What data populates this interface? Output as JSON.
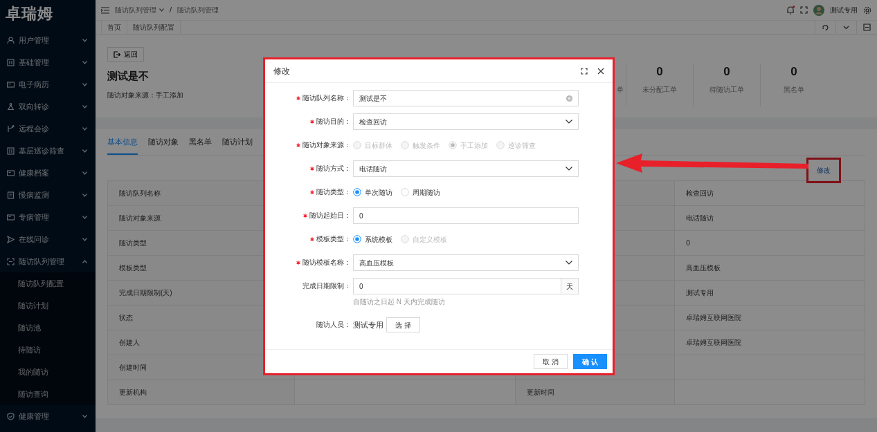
{
  "logo": "卓瑞姆",
  "sidebar": {
    "items": [
      {
        "label": "用户管理",
        "expanded": false
      },
      {
        "label": "基础管理",
        "expanded": false
      },
      {
        "label": "电子病历",
        "expanded": false
      },
      {
        "label": "双向转诊",
        "expanded": false
      },
      {
        "label": "远程会诊",
        "expanded": false
      },
      {
        "label": "基层巡诊筛查",
        "expanded": false
      },
      {
        "label": "健康档案",
        "expanded": false
      },
      {
        "label": "慢病监测",
        "expanded": false
      },
      {
        "label": "专病管理",
        "expanded": false
      },
      {
        "label": "在线问诊",
        "expanded": false
      },
      {
        "label": "随访队列管理",
        "expanded": true,
        "children": [
          {
            "label": "随访队列配置"
          },
          {
            "label": "随访计划"
          },
          {
            "label": "随访池"
          },
          {
            "label": "待随访"
          },
          {
            "label": "我的随访"
          },
          {
            "label": "随访查询"
          }
        ]
      },
      {
        "label": "健康管理",
        "expanded": false
      }
    ]
  },
  "header": {
    "breadcrumb": [
      {
        "label": "随访队列管理",
        "dropdown": true
      },
      {
        "label": "随访队列管理",
        "dropdown": false
      }
    ],
    "separator": "/",
    "has_unread": true,
    "user": "测试专用"
  },
  "page_tabs": [
    {
      "label": "首页"
    },
    {
      "label": "随访队列配置"
    }
  ],
  "summary": {
    "back_button": "返回",
    "title": "测试是不",
    "source": "随访对象来源：手工添加",
    "stats": [
      {
        "label": "单"
      },
      {
        "value": "0",
        "label": "未分配工单"
      },
      {
        "value": "0",
        "label": "待随访工单"
      },
      {
        "value": "0",
        "label": "黑名单"
      }
    ]
  },
  "tabs": [
    {
      "label": "基本信息",
      "selected": true
    },
    {
      "label": "随访对象",
      "selected": false
    },
    {
      "label": "黑名单",
      "selected": false
    },
    {
      "label": "随访计划",
      "selected": false
    }
  ],
  "edit_link": "修改",
  "table": {
    "rows": [
      {
        "label": "随访队列名称",
        "value_2": "检查回访"
      },
      {
        "label": "随访对象来源",
        "value_2": "电话随访"
      },
      {
        "label": "随访类型",
        "value_2": "0"
      },
      {
        "label": "模板类型",
        "value_2": "高血压模板"
      },
      {
        "label": "完成日期限制(天)",
        "value_2": "测试专用"
      },
      {
        "label": "状态",
        "value_2": "卓瑞姆互联网医院"
      },
      {
        "label": "创建人",
        "value_2": "卓瑞姆互联网医院"
      },
      {
        "label": "创建时间"
      },
      {
        "label": "更新机构",
        "label_2": "更新时间"
      }
    ]
  },
  "modal": {
    "title": "修改",
    "fields": [
      {
        "kind": "input",
        "label": "随访队列名称：",
        "required": true,
        "value": "测试是不",
        "clearable": true
      },
      {
        "kind": "select",
        "label": "随访目的：",
        "required": true,
        "value": "检查回访"
      },
      {
        "kind": "radio",
        "label": "随访对象来源：",
        "required": true,
        "options": [
          {
            "label": "目标群体",
            "selected": false,
            "disabled": true
          },
          {
            "label": "触发条件",
            "selected": false,
            "disabled": true
          },
          {
            "label": "手工添加",
            "selected": true,
            "disabled": true
          },
          {
            "label": "巡诊筛查",
            "selected": false,
            "disabled": true
          }
        ]
      },
      {
        "kind": "select",
        "label": "随访方式：",
        "required": true,
        "value": "电话随访"
      },
      {
        "kind": "radio",
        "label": "随访类型：",
        "required": true,
        "options": [
          {
            "label": "单次随访",
            "selected": true,
            "disabled": false
          },
          {
            "label": "周期随访",
            "selected": false,
            "disabled": false
          }
        ]
      },
      {
        "kind": "input",
        "label": "随访起始日：",
        "required": true,
        "value": "0",
        "clearable": false
      },
      {
        "kind": "radio",
        "label": "模板类型：",
        "required": true,
        "options": [
          {
            "label": "系统模板",
            "selected": true,
            "disabled": false
          },
          {
            "label": "自定义模板",
            "selected": false,
            "disabled": true
          }
        ]
      },
      {
        "kind": "select",
        "label": "随访模板名称：",
        "required": true,
        "value": "高血压模板"
      },
      {
        "kind": "addon",
        "label": "完成日期限制：",
        "required": false,
        "value": "0",
        "addon": "天",
        "help": "自随访之日起 N 天内完成随访"
      },
      {
        "kind": "picker",
        "label": "随访人员：",
        "required": false,
        "value": "测试专用",
        "button": "选 择"
      }
    ],
    "cancel": "取 消",
    "confirm": "确 认"
  }
}
